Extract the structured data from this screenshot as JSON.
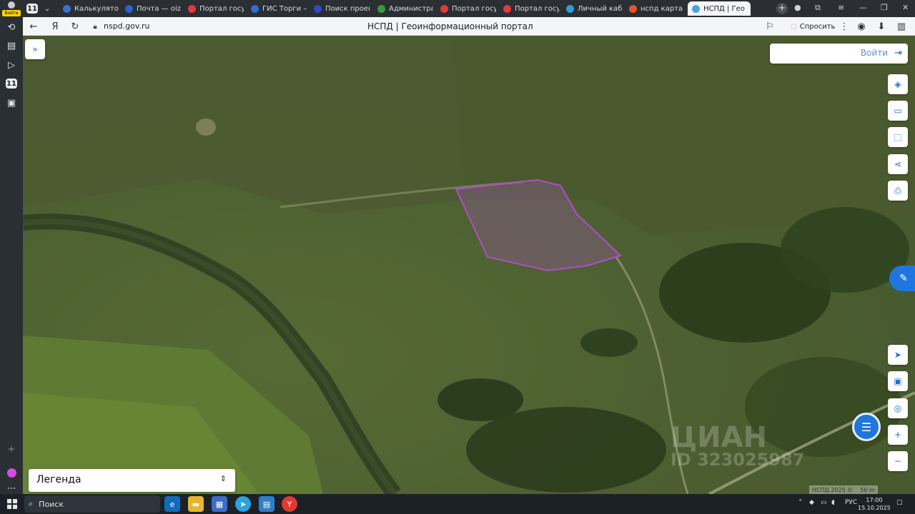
{
  "sidebar": {
    "login_badge": "Войти",
    "badge_count": "11",
    "icons": [
      "history-icon",
      "notes-icon",
      "play-icon",
      "calendar-icon",
      "screen-icon"
    ],
    "add_label": "+",
    "alice_label": "Alice",
    "more_label": "⋯"
  },
  "tabs": [
    {
      "label": "Калькулятор д",
      "favicon_color": "#3b6fd4"
    },
    {
      "label": "Почта — oizoks",
      "favicon_color": "#2a63c9"
    },
    {
      "label": "Портал госуда",
      "favicon_color": "#e23a3a"
    },
    {
      "label": "ГИС Торги – п",
      "favicon_color": "#2f6fd0"
    },
    {
      "label": "Поиск проектс",
      "favicon_color": "#3349c6"
    },
    {
      "label": "Администрац",
      "favicon_color": "#3a9a3a"
    },
    {
      "label": "Портал госуда",
      "favicon_color": "#e23a3a"
    },
    {
      "label": "Портал госуда",
      "favicon_color": "#e23a3a"
    },
    {
      "label": "Личный кабин",
      "favicon_color": "#30a0d0"
    },
    {
      "label": "нспд карта пу",
      "favicon_color": "#e8512b"
    },
    {
      "label": "НСПД | Гео",
      "favicon_color": "#4aa3df",
      "active": true
    }
  ],
  "address": {
    "url": "nspd.gov.ru",
    "page_title": "НСПД | Геоинформационный портал",
    "ask_label": "Спросить"
  },
  "map": {
    "login_label": "Войти",
    "legend_label": "Легенда",
    "tool_icons": [
      "layers-icon",
      "ruler-icon",
      "select-area-icon",
      "share-icon",
      "print-icon"
    ],
    "nav_icons": [
      "locate-icon",
      "screen-icon",
      "search-location-icon",
      "zoom-in-icon",
      "zoom-out-icon"
    ],
    "watermark": "ЦИАН",
    "watermark_id": "ID 323025987",
    "copyright": "НСПД 2025 ©",
    "scale": "50 m"
  },
  "taskbar": {
    "search_label": "Поиск",
    "lang": "РУС",
    "time": "17:00",
    "date": "15.10.2025"
  }
}
